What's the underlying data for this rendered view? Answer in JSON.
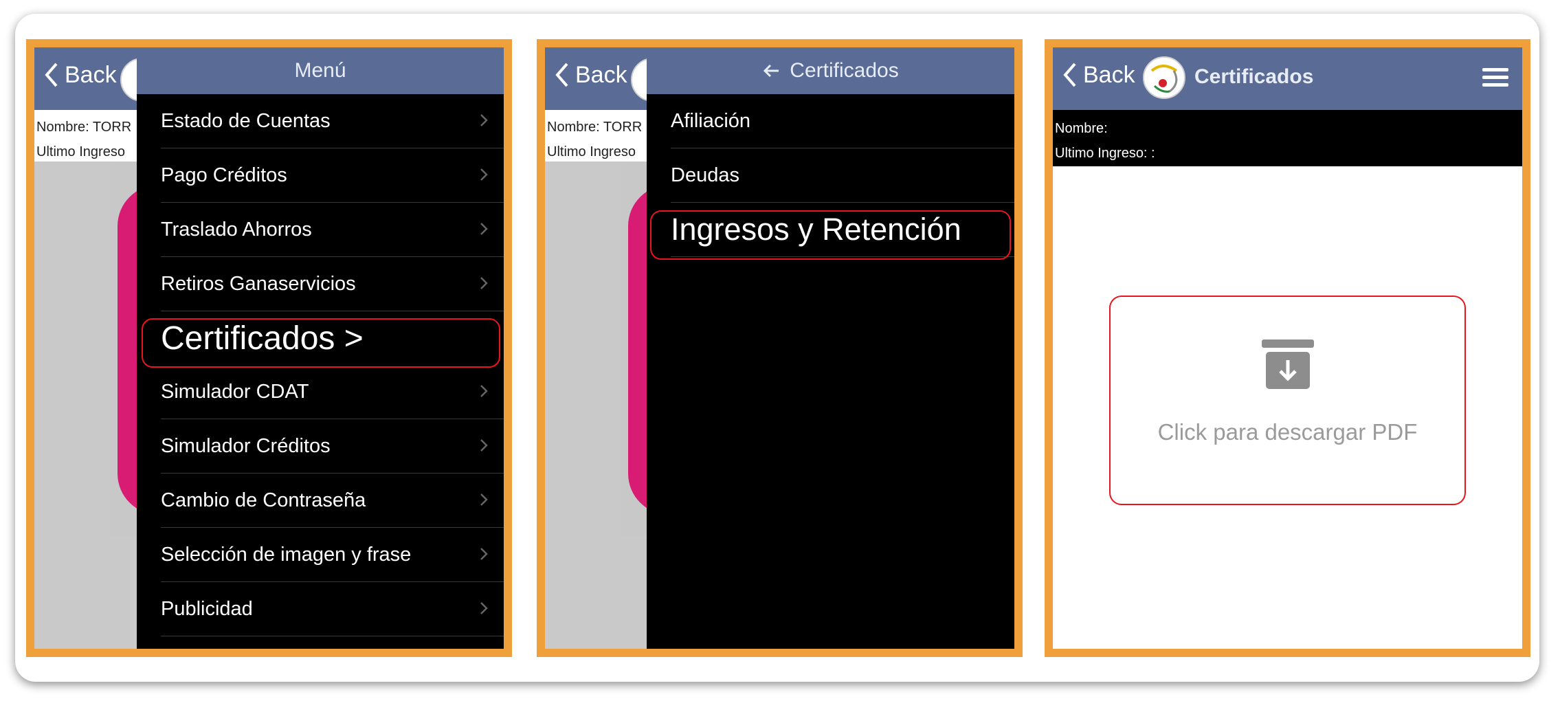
{
  "panel1": {
    "back_label": "Back",
    "info_name": "Nombre: TORR",
    "info_last": "Ultimo Ingreso",
    "drawer_title": "Menú",
    "items": [
      {
        "label": "Estado de Cuentas"
      },
      {
        "label": "Pago Créditos"
      },
      {
        "label": "Traslado Ahorros"
      },
      {
        "label": "Retiros Ganaservicios"
      },
      {
        "label": "Certificados >"
      },
      {
        "label": "Simulador CDAT"
      },
      {
        "label": "Simulador Créditos"
      },
      {
        "label": "Cambio de Contraseña"
      },
      {
        "label": "Selección de imagen y frase"
      },
      {
        "label": "Publicidad"
      }
    ]
  },
  "panel2": {
    "back_label": "Back",
    "info_name": "Nombre: TORR",
    "info_last": "Ultimo Ingreso",
    "drawer_title": "Certificados",
    "items": [
      {
        "label": "Afiliación"
      },
      {
        "label": "Deudas"
      },
      {
        "label": "Ingresos y Retención"
      }
    ]
  },
  "panel3": {
    "back_label": "Back",
    "title": "Certificados",
    "info_name": "Nombre:",
    "info_last": "Ultimo Ingreso: :",
    "pdf_label": "Click para descargar PDF"
  },
  "colors": {
    "frame": "#f0a03a",
    "header": "#5a6c95",
    "highlight": "#e8161c",
    "promo_pink": "#d81b73"
  }
}
